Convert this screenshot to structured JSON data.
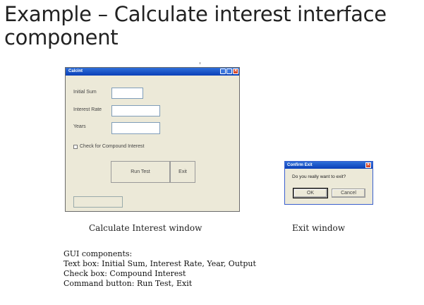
{
  "slide": {
    "title": "Example – Calculate interest interface component"
  },
  "calc_window": {
    "title": "Calcint",
    "labels": {
      "initial_sum": "Initial Sum",
      "interest_rate": "Interest Rate",
      "years": "Years",
      "compound": "Check for Compound Interest"
    },
    "buttons": {
      "run_test": "Run Test",
      "exit": "Exit"
    },
    "fields": {
      "initial_sum": "",
      "interest_rate": "",
      "years": "",
      "output": ""
    },
    "caption": "Calculate Interest window"
  },
  "exit_window": {
    "title": "Confirm Exit",
    "message": "Do you really want to exit?",
    "ok_label": "OK",
    "cancel_label": "Cancel",
    "caption": "Exit window"
  },
  "gui_notes": [
    "GUI components:",
    "Text box: Initial Sum, Interest Rate, Year, Output",
    "Check box: Compound Interest",
    "Command button: Run Test, Exit"
  ]
}
